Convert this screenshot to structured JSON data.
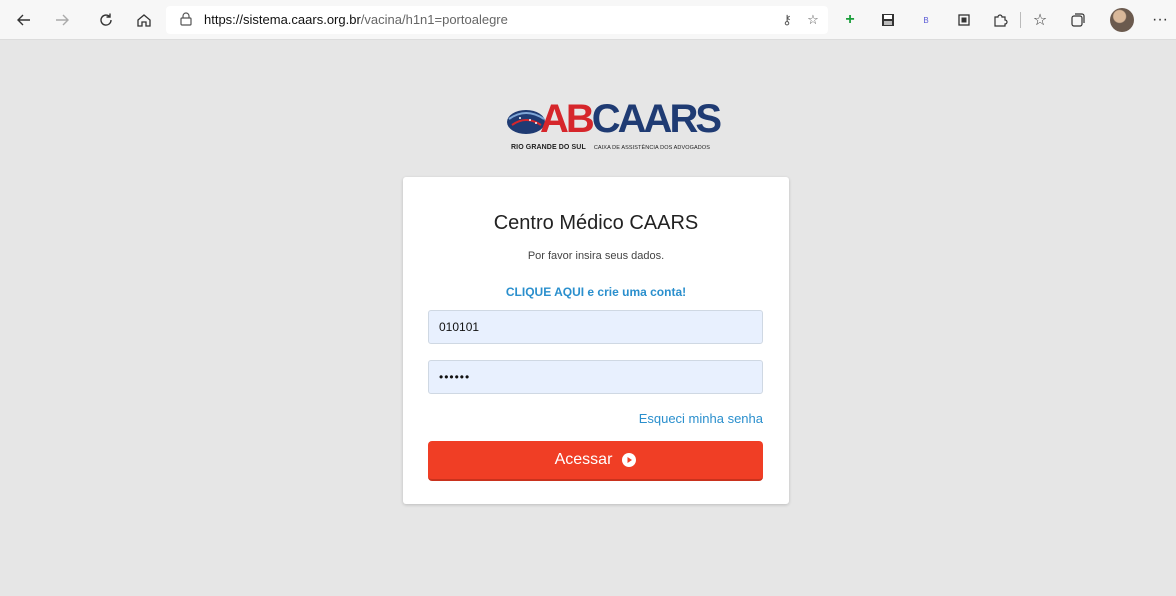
{
  "browser": {
    "url_host": "https://sistema.caars.org.br",
    "url_path": "/vacina/h1n1=portoalegre"
  },
  "logo": {
    "text_ab": "AB",
    "text_caars": "CAARS",
    "tagline_region": "RIO GRANDE DO SUL",
    "tagline_org": "CAIXA DE ASSISTÊNCIA DOS ADVOGADOS"
  },
  "login": {
    "title": "Centro Médico CAARS",
    "subtitle": "Por favor insira seus dados.",
    "signup_link": "CLIQUE AQUI e crie uma conta!",
    "username_value": "010101",
    "password_value": "••••••",
    "forgot_link": "Esqueci minha senha",
    "submit_label": "Acessar"
  },
  "colors": {
    "accent_button": "#f03e25",
    "link": "#2a8fcd",
    "input_bg": "#e8f0fe"
  }
}
